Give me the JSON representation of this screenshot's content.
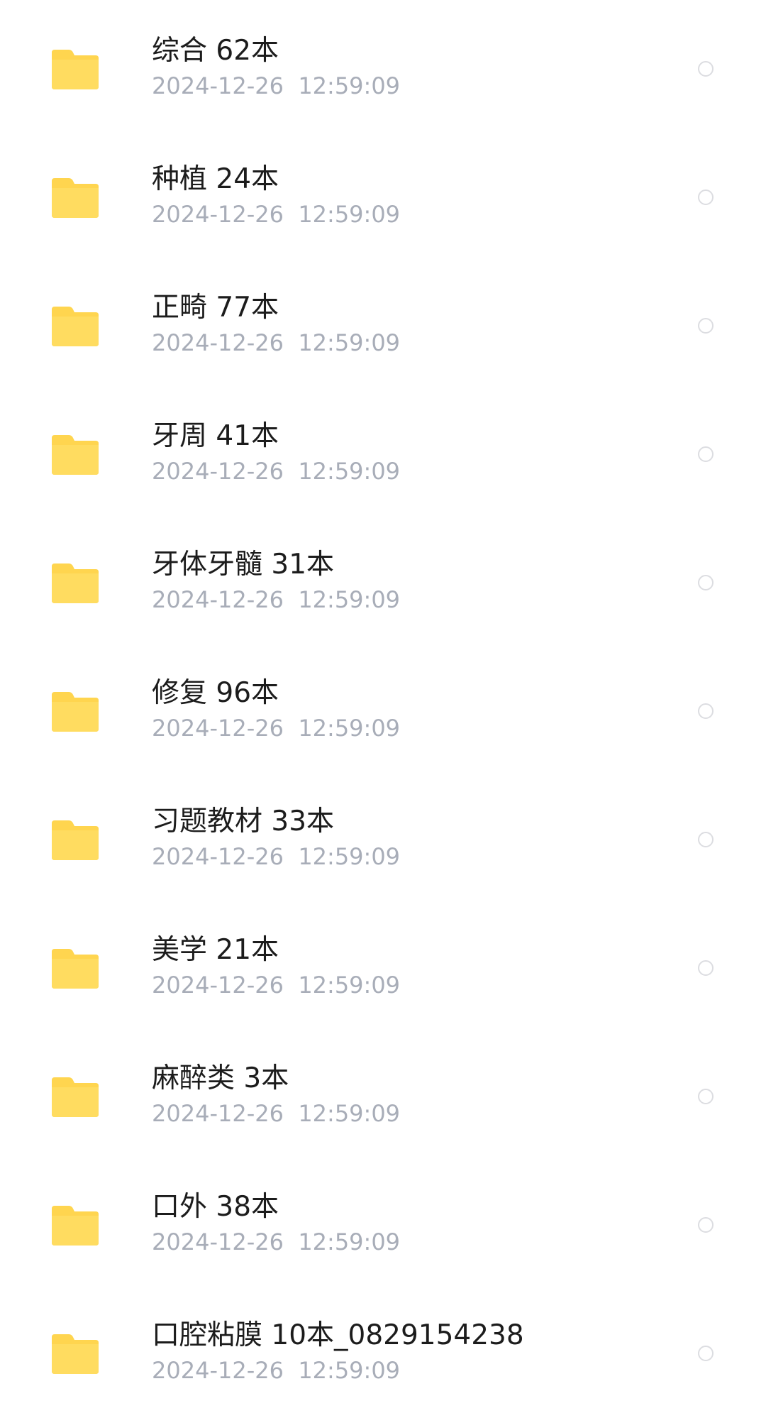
{
  "file_list": {
    "folder_icon_color": "#FFD54F",
    "items": [
      {
        "name": "综合 62本",
        "date": "2024-12-26  12:59:09"
      },
      {
        "name": "种植 24本",
        "date": "2024-12-26  12:59:09"
      },
      {
        "name": "正畸 77本",
        "date": "2024-12-26  12:59:09"
      },
      {
        "name": "牙周 41本",
        "date": "2024-12-26  12:59:09"
      },
      {
        "name": "牙体牙髓 31本",
        "date": "2024-12-26  12:59:09"
      },
      {
        "name": "修复 96本",
        "date": "2024-12-26  12:59:09"
      },
      {
        "name": "习题教材 33本",
        "date": "2024-12-26  12:59:09"
      },
      {
        "name": "美学 21本",
        "date": "2024-12-26  12:59:09"
      },
      {
        "name": "麻醉类 3本",
        "date": "2024-12-26  12:59:09"
      },
      {
        "name": "口外 38本",
        "date": "2024-12-26  12:59:09"
      },
      {
        "name": "口腔粘膜 10本_0829154238",
        "date": "2024-12-26  12:59:09"
      }
    ]
  }
}
